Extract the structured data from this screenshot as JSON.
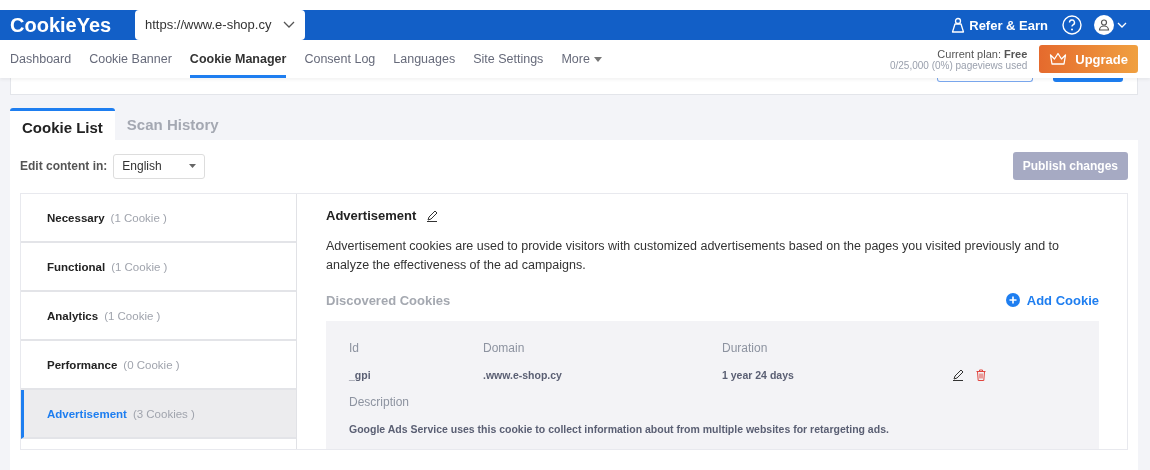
{
  "header": {
    "logo": "CookieYes",
    "site_select": {
      "value": "https://www.e-shop.cy"
    },
    "refer": "Refer & Earn"
  },
  "nav": {
    "items": [
      {
        "label": "Dashboard",
        "selected": false
      },
      {
        "label": "Cookie Banner",
        "selected": false
      },
      {
        "label": "Cookie Manager",
        "selected": true
      },
      {
        "label": "Consent Log",
        "selected": false
      },
      {
        "label": "Languages",
        "selected": false
      },
      {
        "label": "Site Settings",
        "selected": false
      },
      {
        "label": "More",
        "selected": false
      }
    ],
    "plan_label": "Current plan:",
    "plan": "Free",
    "usage": "0/25,000 (0%) pageviews used",
    "upgrade": "Upgrade"
  },
  "tabs": [
    {
      "label": "Cookie List",
      "selected": true
    },
    {
      "label": "Scan History",
      "selected": false
    }
  ],
  "edit_content": {
    "label": "Edit content in:",
    "value": "English"
  },
  "publish": {
    "label": "Publish changes",
    "disabled": true
  },
  "categories": [
    {
      "name": "Necessary",
      "count": "(1 Cookie )",
      "selected": false
    },
    {
      "name": "Functional",
      "count": "(1 Cookie )",
      "selected": false
    },
    {
      "name": "Analytics",
      "count": "(1 Cookie )",
      "selected": false
    },
    {
      "name": "Performance",
      "count": "(0 Cookie )",
      "selected": false
    },
    {
      "name": "Advertisement",
      "count": "(3 Cookies )",
      "selected": true
    }
  ],
  "detail": {
    "title": "Advertisement",
    "description": "Advertisement cookies are used to provide visitors with customized advertisements based on the pages you visited previously and to analyze the effectiveness of the ad campaigns.",
    "discovered": "Discovered Cookies",
    "add": "Add Cookie",
    "columns": [
      "Id",
      "Domain",
      "Duration"
    ],
    "cookies": [
      {
        "id": "_gpi",
        "domain": ".www.e-shop.cy",
        "duration": "1 year 24 days",
        "description_label": "Description",
        "description": "Google Ads Service uses this cookie to collect information about from multiple websites for retargeting ads."
      }
    ]
  }
}
